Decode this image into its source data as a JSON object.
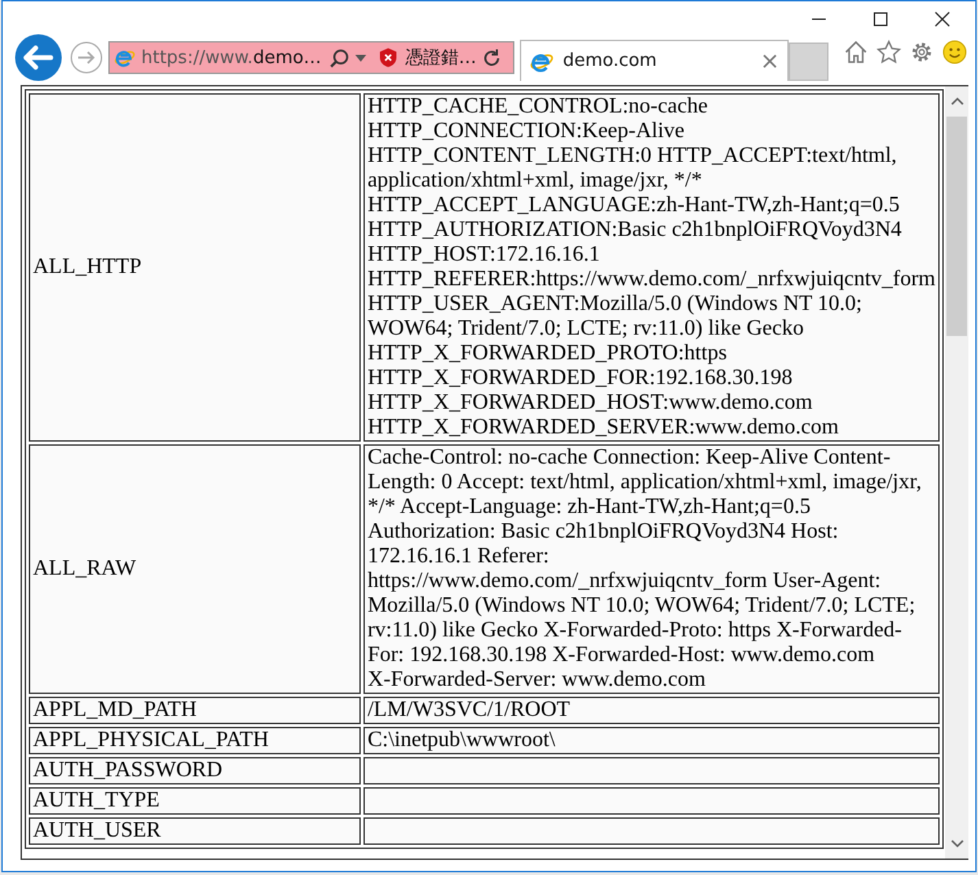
{
  "address_bar": {
    "scheme": "https://www.",
    "host": "demo…",
    "certificate_error": "憑證錯…"
  },
  "tabs": [
    {
      "label": "demo.com",
      "selected": true,
      "close": "×"
    }
  ],
  "table": {
    "rows": [
      {
        "name": "ALL_HTTP",
        "value": [
          "HTTP_CACHE_CONTROL:no-cache",
          "HTTP_CONNECTION:Keep-Alive",
          "HTTP_CONTENT_LENGTH:0 HTTP_ACCEPT:text/html,",
          "application/xhtml+xml, image/jxr, */*",
          "HTTP_ACCEPT_LANGUAGE:zh-Hant-TW,zh-Hant;q=0.5",
          "HTTP_AUTHORIZATION:Basic c2h1bnplOiFRQVoyd3N4",
          "HTTP_HOST:172.16.16.1",
          "HTTP_REFERER:https://www.demo.com/_nrfxwjuiqcntv_form",
          "HTTP_USER_AGENT:Mozilla/5.0 (Windows NT 10.0;",
          "WOW64; Trident/7.0; LCTE; rv:11.0) like Gecko",
          "HTTP_X_FORWARDED_PROTO:https",
          "HTTP_X_FORWARDED_FOR:192.168.30.198",
          "HTTP_X_FORWARDED_HOST:www.demo.com",
          "HTTP_X_FORWARDED_SERVER:www.demo.com"
        ]
      },
      {
        "name": "ALL_RAW",
        "value": [
          "Cache-Control: no-cache Connection: Keep-Alive Content-",
          "Length: 0 Accept: text/html, application/xhtml+xml, image/jxr,",
          "*/* Accept-Language: zh-Hant-TW,zh-Hant;q=0.5",
          "Authorization: Basic c2h1bnplOiFRQVoyd3N4 Host:",
          "172.16.16.1 Referer:",
          "https://www.demo.com/_nrfxwjuiqcntv_form User-Agent:",
          "Mozilla/5.0 (Windows NT 10.0; WOW64; Trident/7.0; LCTE;",
          "rv:11.0) like Gecko X-Forwarded-Proto: https X-Forwarded-",
          "For: 192.168.30.198 X-Forwarded-Host: www.demo.com",
          "X-Forwarded-Server: www.demo.com"
        ]
      },
      {
        "name": "APPL_MD_PATH",
        "value": [
          "/LM/W3SVC/1/ROOT"
        ]
      },
      {
        "name": "APPL_PHYSICAL_PATH",
        "value": [
          "C:\\inetpub\\wwwroot\\"
        ]
      },
      {
        "name": "AUTH_PASSWORD",
        "value": []
      },
      {
        "name": "AUTH_TYPE",
        "value": []
      },
      {
        "name": "AUTH_USER",
        "value": []
      }
    ]
  }
}
